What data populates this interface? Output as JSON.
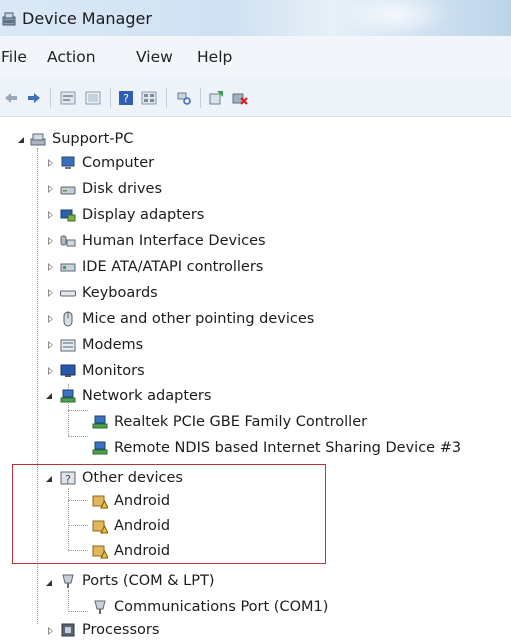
{
  "window": {
    "title": "Device Manager"
  },
  "menu": [
    "File",
    "Action",
    "View",
    "Help"
  ],
  "toolbar": {
    "icons": [
      "back-icon",
      "forward-icon",
      "properties-icon",
      "update-icon",
      "help-icon",
      "view-icon",
      "scan-icon",
      "update-driver-icon",
      "uninstall-icon"
    ]
  },
  "tree": {
    "root": "Support-PC",
    "computer": "Computer",
    "disk_drives": "Disk drives",
    "display_adapters": "Display adapters",
    "hid": "Human Interface Devices",
    "ide": "IDE ATA/ATAPI controllers",
    "keyboards": "Keyboards",
    "mice": "Mice and other pointing devices",
    "modems": "Modems",
    "monitors": "Monitors",
    "network_adapters": "Network adapters",
    "net_children": [
      "Realtek PCIe GBE Family Controller",
      "Remote NDIS based Internet Sharing Device #3"
    ],
    "other_devices": "Other devices",
    "other_children": [
      "Android",
      "Android",
      "Android"
    ],
    "ports": "Ports (COM & LPT)",
    "ports_children": [
      "Communications Port (COM1)"
    ],
    "processors": "Processors"
  },
  "colors": {
    "highlight_border": "#c0303a",
    "warning": "#f2c230"
  }
}
